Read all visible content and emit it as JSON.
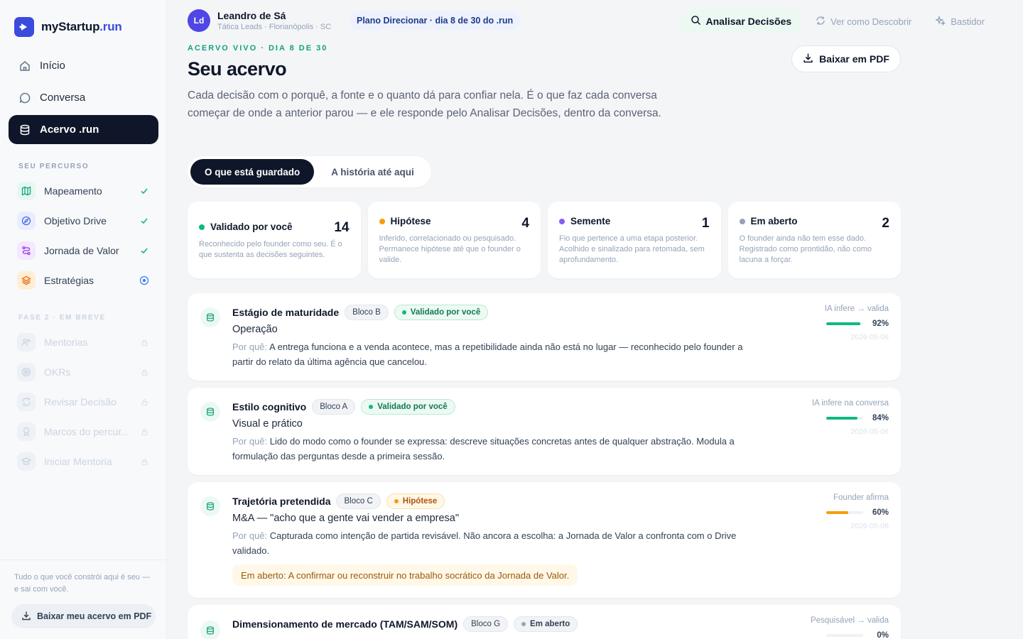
{
  "brand": {
    "name_main": "myStartup",
    "name_accent": ".run",
    "color": "#3b4bdb"
  },
  "nav": [
    {
      "label": "Início",
      "icon": "home-icon",
      "active": false
    },
    {
      "label": "Conversa",
      "icon": "chat-icon",
      "active": false
    },
    {
      "label": "Acervo .run",
      "icon": "database-icon",
      "active": true
    }
  ],
  "sidebar": {
    "section_percurso": "SEU PERCURSO",
    "percurso": [
      {
        "label": "Mapeamento",
        "icon": "map-icon",
        "status": "done"
      },
      {
        "label": "Objetivo Drive",
        "icon": "compass-icon",
        "status": "done"
      },
      {
        "label": "Jornada de Valor",
        "icon": "route-icon",
        "status": "done"
      },
      {
        "label": "Estratégias",
        "icon": "layers-icon",
        "status": "current"
      }
    ],
    "section_fase2": "FASE 2 · EM BREVE",
    "fase2": [
      {
        "label": "Mentorias",
        "icon": "users-icon"
      },
      {
        "label": "OKRs",
        "icon": "target-icon"
      },
      {
        "label": "Revisar Decisão",
        "icon": "refresh-icon"
      },
      {
        "label": "Marcos do percur...",
        "icon": "award-icon"
      },
      {
        "label": "Iniciar Mentoria",
        "icon": "graduation-icon"
      }
    ],
    "footer_text": "Tudo o que você constrói aqui é seu — e sai com você.",
    "footer_button": "Baixar meu acervo em PDF"
  },
  "user": {
    "initials": "Ld",
    "name": "Leandro de Sá",
    "subtitle": "Tática Leads · Florianópolis · SC"
  },
  "plan": "Plano Direcionar · dia 8 de 30 do .run",
  "top_actions": {
    "analyze": "Analisar Decisões",
    "view_as": "Ver como Descobrir",
    "backstage": "Bastidor"
  },
  "header": {
    "eyebrow": "ACERVO VIVO · DIA 8 DE 30",
    "title": "Seu acervo",
    "description": "Cada decisão com o porquê, a fonte e o quanto dá para confiar nela. É o que faz cada conversa começar de onde a anterior parou — e ele responde pelo Analisar Decisões, dentro da conversa.",
    "pdf_button": "Baixar em PDF"
  },
  "tabs": [
    {
      "label": "O que está guardado",
      "active": true
    },
    {
      "label": "A história até aqui",
      "active": false
    }
  ],
  "stats": [
    {
      "label": "Validado por você",
      "count": "14",
      "color": "#10b981",
      "desc": "Reconhecido pelo founder como seu. É o que sustenta as decisões seguintes."
    },
    {
      "label": "Hipótese",
      "count": "4",
      "color": "#f59e0b",
      "desc": "Inferido, correlacionado ou pesquisado. Permanece hipótese até que o founder o valide."
    },
    {
      "label": "Semente",
      "count": "1",
      "color": "#8b5cf6",
      "desc": "Fio que pertence a uma etapa posterior. Acolhido e sinalizado para retomada, sem aprofundamento."
    },
    {
      "label": "Em aberto",
      "count": "2",
      "color": "#94a3b8",
      "desc": "O founder ainda não tem esse dado. Registrado como prontidão, não como lacuna a forçar."
    }
  ],
  "why_label": "Por quê:",
  "decisions": [
    {
      "title": "Estágio de maturidade",
      "bloco": "Bloco B",
      "status": "Validado por você",
      "status_kind": "validated",
      "value": "Operação",
      "why": "A entrega funciona e a venda acontece, mas a repetibilidade ainda não está no lugar — reconhecido pelo founder a partir do relato da última agência que cancelou.",
      "source": "IA infere → valida",
      "confidence": 92,
      "confidence_label": "92%",
      "date": "2026-05-06",
      "bar_color": "#10b981"
    },
    {
      "title": "Estilo cognitivo",
      "bloco": "Bloco A",
      "status": "Validado por você",
      "status_kind": "validated",
      "value": "Visual e prático",
      "why": "Lido do modo como o founder se expressa: descreve situações concretas antes de qualquer abstração. Modula a formulação das perguntas desde a primeira sessão.",
      "source": "IA infere na conversa",
      "confidence": 84,
      "confidence_label": "84%",
      "date": "2026-05-06",
      "bar_color": "#10b981"
    },
    {
      "title": "Trajetória pretendida",
      "bloco": "Bloco C",
      "status": "Hipótese",
      "status_kind": "hypo",
      "value": "M&A — \"acho que a gente vai vender a empresa\"",
      "why": "Capturada como intenção de partida revisável. Não ancora a escolha: a Jornada de Valor a confronta com o Drive validado.",
      "source": "Founder afirma",
      "confidence": 60,
      "confidence_label": "60%",
      "date": "2026-05-08",
      "bar_color": "#f59e0b",
      "open_note": "Em aberto: A confirmar ou reconstruir no trabalho socrático da Jornada de Valor."
    },
    {
      "title": "Dimensionamento de mercado (TAM/SAM/SOM)",
      "bloco": "Bloco G",
      "status": "Em aberto",
      "status_kind": "open",
      "source": "Pesquisável → valida",
      "confidence": 0,
      "confidence_label": "0%",
      "bar_color": "#94a3b8"
    }
  ]
}
